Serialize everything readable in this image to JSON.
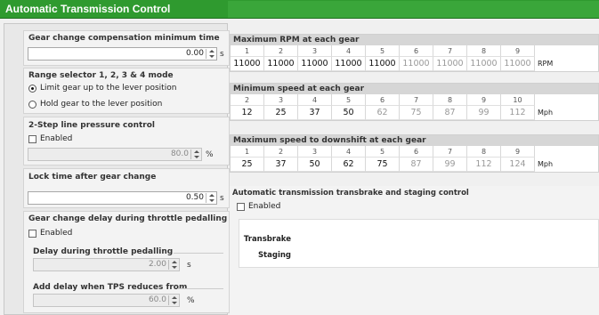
{
  "window": {
    "title": "Automatic Transmission Control"
  },
  "gear_comp": {
    "label": "Gear change compensation minimum time",
    "value": "0.00",
    "unit": "s"
  },
  "range_selector": {
    "label": "Range selector 1, 2, 3 & 4 mode",
    "options": [
      "Limit gear up to the lever position",
      "Hold gear to the lever position"
    ],
    "selected": 0
  },
  "line_pressure": {
    "label": "2-Step line pressure control",
    "enabled_label": "Enabled",
    "value": "80.0",
    "unit": "%"
  },
  "lock_time": {
    "label": "Lock time after gear change",
    "value": "0.50",
    "unit": "s"
  },
  "throttle_delay": {
    "label": "Gear change delay during throttle pedalling",
    "enabled_label": "Enabled",
    "delay_label": "Delay during throttle pedalling",
    "delay_value": "2.00",
    "delay_unit": "s",
    "tps_label": "Add delay when TPS reduces from",
    "tps_value": "60.0",
    "tps_unit": "%"
  },
  "rpm_table": {
    "title": "Maximum RPM at each gear",
    "headers": [
      "1",
      "2",
      "3",
      "4",
      "5",
      "6",
      "7",
      "8",
      "9"
    ],
    "values": [
      "11000",
      "11000",
      "11000",
      "11000",
      "11000",
      "11000",
      "11000",
      "11000",
      "11000"
    ],
    "unit": "RPM"
  },
  "min_speed_table": {
    "title": "Minimum speed at each gear",
    "headers": [
      "2",
      "3",
      "4",
      "5",
      "6",
      "7",
      "8",
      "9",
      "10"
    ],
    "values": [
      "12",
      "25",
      "37",
      "50",
      "62",
      "75",
      "87",
      "99",
      "112"
    ],
    "unit": "Mph"
  },
  "downshift_table": {
    "title": "Maximum speed to downshift at each gear",
    "headers": [
      "1",
      "2",
      "3",
      "4",
      "5",
      "6",
      "7",
      "8",
      "9"
    ],
    "values": [
      "25",
      "37",
      "50",
      "62",
      "75",
      "87",
      "99",
      "112",
      "124"
    ],
    "unit": "Mph"
  },
  "transbrake": {
    "title": "Automatic transmission transbrake and staging control",
    "enabled_label": "Enabled",
    "transbrake_label": "Transbrake",
    "staging_label": "Staging"
  }
}
